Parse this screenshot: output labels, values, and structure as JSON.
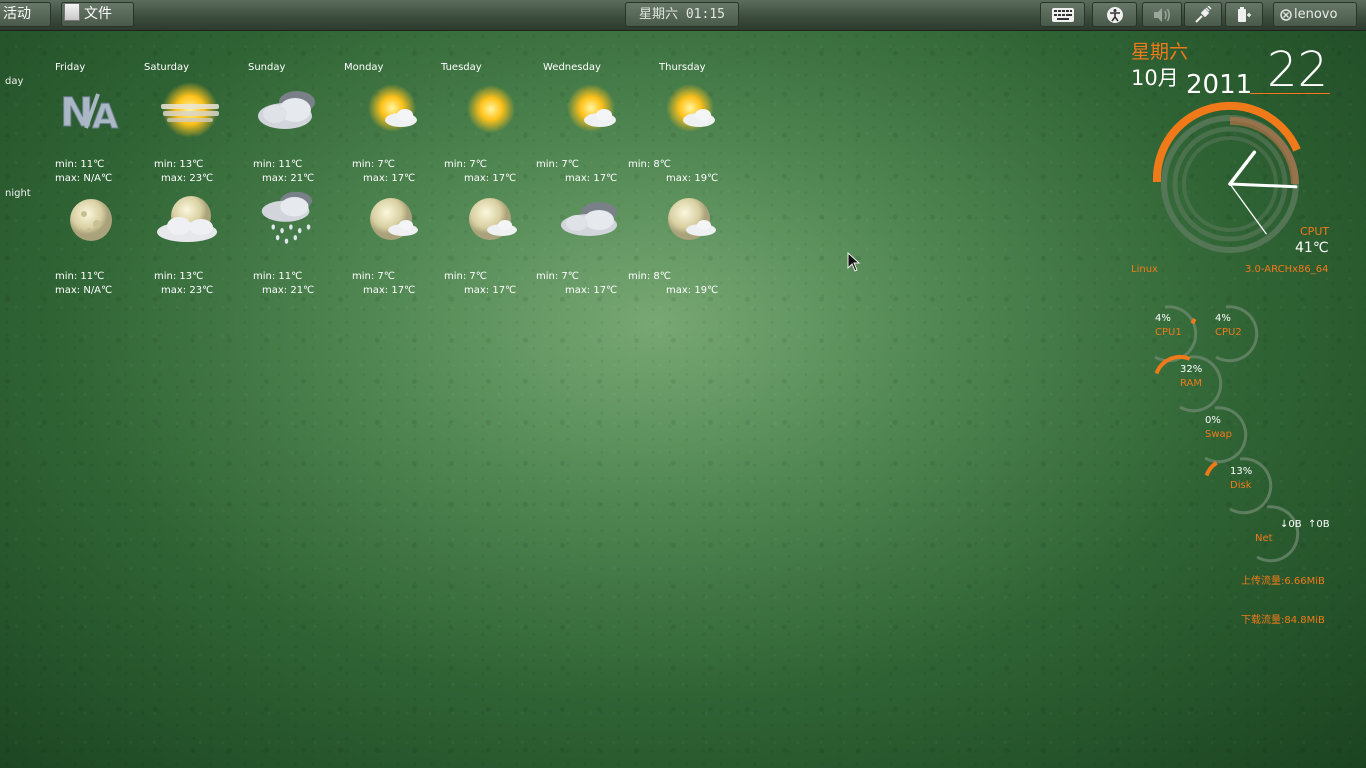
{
  "topbar": {
    "activities_label": "活动",
    "app_menu_label": "文件",
    "clock": "星期六 01:15",
    "user_name": "lenovo"
  },
  "weather": {
    "day_row_label": "day",
    "night_row_label": "night",
    "days": [
      {
        "name": "Friday",
        "day_icon": "na-icon",
        "night_icon": "full-moon-icon",
        "day_min": "min: 11℃",
        "day_max": "max: N/A℃",
        "night_min": "min: 11℃",
        "night_max": "max: N/A℃"
      },
      {
        "name": "Saturday",
        "day_icon": "hazy-sun-icon",
        "night_icon": "moon-cloudy-icon",
        "day_min": "min: 13℃",
        "day_max": "max: 23℃",
        "night_min": "min: 13℃",
        "night_max": "max: 23℃"
      },
      {
        "name": "Sunday",
        "day_icon": "cloudy-icon",
        "night_icon": "rain-icon",
        "day_min": "min: 11℃",
        "day_max": "max: 21℃",
        "night_min": "min: 11℃",
        "night_max": "max: 21℃"
      },
      {
        "name": "Monday",
        "day_icon": "sun-cloud-icon",
        "night_icon": "moon-cloud-icon",
        "day_min": "min: 7℃",
        "day_max": "max: 17℃",
        "night_min": "min: 7℃",
        "night_max": "max: 17℃"
      },
      {
        "name": "Tuesday",
        "day_icon": "sun-icon",
        "night_icon": "moon-cloud-icon",
        "day_min": "min: 7℃",
        "day_max": "max: 17℃",
        "night_min": "min: 7℃",
        "night_max": "max: 17℃"
      },
      {
        "name": "Wednesday",
        "day_icon": "sun-cloud-icon",
        "night_icon": "cloudy-icon",
        "day_min": "min: 7℃",
        "day_max": "max: 17℃",
        "night_min": "min: 7℃",
        "night_max": "max: 17℃"
      },
      {
        "name": "Thursday",
        "day_icon": "sun-cloud-icon",
        "night_icon": "moon-cloud-icon",
        "day_min": "min: 8℃",
        "day_max": "max: 19℃",
        "night_min": "min: 8℃",
        "night_max": "max: 19℃"
      }
    ]
  },
  "calendar": {
    "weekday": "星期六",
    "month": "10月",
    "year": "2011",
    "day": "22"
  },
  "clock_widget": {
    "hour": 1,
    "minute": 15,
    "second": 24,
    "cpu_temp_label": "CPUT",
    "cpu_temp_value": "41℃",
    "os_label": "Linux",
    "kernel_label": "3.0-ARCHx86_64"
  },
  "system": {
    "cpu1": {
      "label": "CPU1",
      "value": "4%",
      "fraction": 0.04
    },
    "cpu2": {
      "label": "CPU2",
      "value": "4%",
      "fraction": 0.04
    },
    "ram": {
      "label": "RAM",
      "value": "32%",
      "fraction": 0.32
    },
    "swap": {
      "label": "Swap",
      "value": "0%",
      "fraction": 0.0
    },
    "disk": {
      "label": "Disk",
      "value": "13%",
      "fraction": 0.13
    },
    "net": {
      "label": "Net",
      "down": "↓0B",
      "up": "↑0B"
    },
    "upload_total": "上传流量:6.66MiB",
    "download_total": "下载流量:84.8MiB"
  },
  "colors": {
    "accent": "#f07a1a",
    "ring": "#5d7a5e"
  }
}
